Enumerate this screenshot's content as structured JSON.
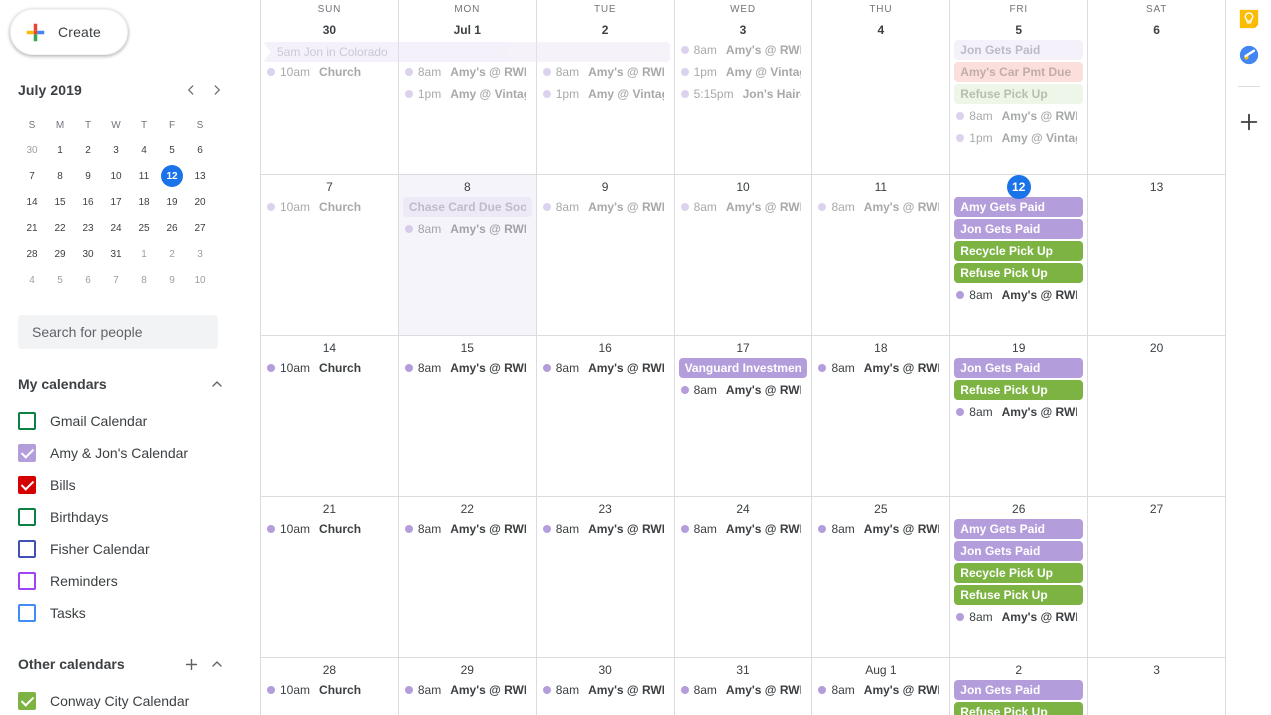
{
  "sidebar": {
    "create_button": {
      "label": "Create",
      "icon": "google-plus-icon"
    },
    "mini_calendar": {
      "title": "July 2019",
      "prev_label": "‹",
      "next_label": "›",
      "weekday_headers": [
        "S",
        "M",
        "T",
        "W",
        "T",
        "F",
        "S"
      ],
      "weeks": [
        [
          {
            "d": "30",
            "muted": true
          },
          {
            "d": "1"
          },
          {
            "d": "2"
          },
          {
            "d": "3"
          },
          {
            "d": "4"
          },
          {
            "d": "5"
          },
          {
            "d": "6"
          }
        ],
        [
          {
            "d": "7"
          },
          {
            "d": "8"
          },
          {
            "d": "9"
          },
          {
            "d": "10"
          },
          {
            "d": "11"
          },
          {
            "d": "12",
            "today": true
          },
          {
            "d": "13"
          }
        ],
        [
          {
            "d": "14"
          },
          {
            "d": "15"
          },
          {
            "d": "16"
          },
          {
            "d": "17"
          },
          {
            "d": "18"
          },
          {
            "d": "19"
          },
          {
            "d": "20"
          }
        ],
        [
          {
            "d": "21"
          },
          {
            "d": "22"
          },
          {
            "d": "23"
          },
          {
            "d": "24"
          },
          {
            "d": "25"
          },
          {
            "d": "26"
          },
          {
            "d": "27"
          }
        ],
        [
          {
            "d": "28"
          },
          {
            "d": "29"
          },
          {
            "d": "30"
          },
          {
            "d": "31"
          },
          {
            "d": "1",
            "muted": true
          },
          {
            "d": "2",
            "muted": true
          },
          {
            "d": "3",
            "muted": true
          }
        ],
        [
          {
            "d": "4",
            "muted": true
          },
          {
            "d": "5",
            "muted": true
          },
          {
            "d": "6",
            "muted": true
          },
          {
            "d": "7",
            "muted": true
          },
          {
            "d": "8",
            "muted": true
          },
          {
            "d": "9",
            "muted": true
          },
          {
            "d": "10",
            "muted": true
          }
        ]
      ]
    },
    "search_people": {
      "placeholder": "Search for people",
      "value": ""
    },
    "my_calendars": {
      "title": "My calendars",
      "collapse_icon": "chevron-up-icon",
      "items": [
        {
          "label": "Gmail Calendar",
          "color": "#0b8043",
          "checked": false
        },
        {
          "label": "Amy & Jon's Calendar",
          "color": "#b39ddb",
          "checked": true
        },
        {
          "label": "Bills",
          "color": "#d50000",
          "checked": true
        },
        {
          "label": "Birthdays",
          "color": "#0b8043",
          "checked": false
        },
        {
          "label": "Fisher Calendar",
          "color": "#3f51b5",
          "checked": false
        },
        {
          "label": "Reminders",
          "color": "#a142f4",
          "checked": false
        },
        {
          "label": "Tasks",
          "color": "#3f8df4",
          "checked": false
        }
      ]
    },
    "other_calendars": {
      "title": "Other calendars",
      "add_icon": "plus-icon",
      "collapse_icon": "chevron-up-icon",
      "items": [
        {
          "label": "Conway City Calendar",
          "color": "#7cb342",
          "checked": true
        }
      ]
    }
  },
  "rail": {
    "items": [
      {
        "name": "google-keep-icon",
        "label": "Keep"
      },
      {
        "name": "google-tasks-icon",
        "label": "Tasks"
      }
    ],
    "add_label": "+"
  },
  "colors": {
    "accent_blue": "#1a73e8",
    "purple_solid": "#b39ddb",
    "purple_pale": "#e9e2f5",
    "green_solid": "#7cb342",
    "green_pale": "#dbead0",
    "red_pale": "#f4b9b6",
    "grid_line": "#dadce0",
    "text": "#3c4043",
    "muted_text": "#70757a"
  },
  "calendar": {
    "weekday_headers": [
      "SUN",
      "MON",
      "TUE",
      "WED",
      "THU",
      "FRI",
      "SAT"
    ],
    "spanning_event": {
      "label": "5am Jon in Colorado",
      "bg": "#e9e2f5",
      "fg": "#8a8a9e",
      "start_col": 0,
      "span_cols": 3,
      "continues_from_previous": true
    },
    "weeks": [
      {
        "id": "week-jun30",
        "days": [
          {
            "num": "30",
            "shaded": false,
            "faded": true,
            "reserve_span": true,
            "events": [
              {
                "type": "timed",
                "time": "10am",
                "title": "Church",
                "dot": "#b39ddb"
              }
            ]
          },
          {
            "num": "Jul 1",
            "shaded": false,
            "faded": true,
            "reserve_span": true,
            "events": [
              {
                "type": "timed",
                "time": "8am",
                "title": "Amy's @ RWD",
                "dot": "#b39ddb"
              },
              {
                "type": "timed",
                "time": "1pm",
                "title": "Amy @ Vintage",
                "dot": "#b39ddb"
              }
            ]
          },
          {
            "num": "2",
            "shaded": false,
            "faded": true,
            "reserve_span": true,
            "events": [
              {
                "type": "timed",
                "time": "8am",
                "title": "Amy's @ RWD",
                "dot": "#b39ddb"
              },
              {
                "type": "timed",
                "time": "1pm",
                "title": "Amy @ Vintage",
                "dot": "#b39ddb"
              }
            ]
          },
          {
            "num": "3",
            "shaded": false,
            "faded": true,
            "reserve_span": false,
            "events": [
              {
                "type": "timed",
                "time": "8am",
                "title": "Amy's @ RWD",
                "dot": "#b39ddb"
              },
              {
                "type": "timed",
                "time": "1pm",
                "title": "Amy @ Vintage",
                "dot": "#b39ddb"
              },
              {
                "type": "timed",
                "time": "5:15pm",
                "title": "Jon's Haircut",
                "dot": "#b39ddb"
              }
            ]
          },
          {
            "num": "4",
            "shaded": false,
            "faded": true,
            "reserve_span": false,
            "events": []
          },
          {
            "num": "5",
            "shaded": false,
            "faded": true,
            "reserve_span": false,
            "events": [
              {
                "type": "chip",
                "title": "Jon Gets Paid",
                "bg": "#e9e2f5",
                "fg": "#6b6b80"
              },
              {
                "type": "chip",
                "title": "Amy's Car Pmt Due",
                "bg": "#f4b9b6",
                "fg": "#7a4a47"
              },
              {
                "type": "chip",
                "title": "Refuse Pick Up",
                "bg": "#dbead0",
                "fg": "#5d7350"
              },
              {
                "type": "timed",
                "time": "8am",
                "title": "Amy's @ RWD",
                "dot": "#b39ddb"
              },
              {
                "type": "timed",
                "time": "1pm",
                "title": "Amy @ Vintage",
                "dot": "#b39ddb"
              }
            ]
          },
          {
            "num": "6",
            "shaded": false,
            "faded": true,
            "reserve_span": false,
            "events": []
          }
        ]
      },
      {
        "id": "week-jul7",
        "days": [
          {
            "num": "7",
            "shaded": false,
            "faded": true,
            "events": [
              {
                "type": "timed",
                "time": "10am",
                "title": "Church",
                "dot": "#b39ddb"
              }
            ]
          },
          {
            "num": "8",
            "shaded": true,
            "faded": true,
            "events": [
              {
                "type": "chip",
                "title": "Chase Card Due Soon",
                "bg": "#e4dcf2",
                "fg": "#7d7a90"
              },
              {
                "type": "timed",
                "time": "8am",
                "title": "Amy's @ RWD",
                "dot": "#b39ddb"
              }
            ]
          },
          {
            "num": "9",
            "shaded": false,
            "faded": true,
            "events": [
              {
                "type": "timed",
                "time": "8am",
                "title": "Amy's @ RWD",
                "dot": "#b39ddb"
              }
            ]
          },
          {
            "num": "10",
            "shaded": false,
            "faded": true,
            "events": [
              {
                "type": "timed",
                "time": "8am",
                "title": "Amy's @ RWD",
                "dot": "#b39ddb"
              }
            ]
          },
          {
            "num": "11",
            "shaded": false,
            "faded": true,
            "events": [
              {
                "type": "timed",
                "time": "8am",
                "title": "Amy's @ RWD",
                "dot": "#b39ddb"
              }
            ]
          },
          {
            "num": "12",
            "today": true,
            "shaded": false,
            "faded": false,
            "events": [
              {
                "type": "chip",
                "title": "Amy Gets Paid",
                "bg": "#b39ddb",
                "fg": "#ffffff"
              },
              {
                "type": "chip",
                "title": "Jon Gets Paid",
                "bg": "#b39ddb",
                "fg": "#ffffff"
              },
              {
                "type": "chip",
                "title": "Recycle Pick Up",
                "bg": "#7cb342",
                "fg": "#ffffff"
              },
              {
                "type": "chip",
                "title": "Refuse Pick Up",
                "bg": "#7cb342",
                "fg": "#ffffff"
              },
              {
                "type": "timed",
                "time": "8am",
                "title": "Amy's @ RWD",
                "dot": "#b39ddb"
              }
            ]
          },
          {
            "num": "13",
            "shaded": false,
            "faded": false,
            "events": []
          }
        ]
      },
      {
        "id": "week-jul14",
        "days": [
          {
            "num": "14",
            "shaded": false,
            "faded": false,
            "events": [
              {
                "type": "timed",
                "time": "10am",
                "title": "Church",
                "dot": "#b39ddb"
              }
            ]
          },
          {
            "num": "15",
            "shaded": false,
            "faded": false,
            "events": [
              {
                "type": "timed",
                "time": "8am",
                "title": "Amy's @ RWD",
                "dot": "#b39ddb"
              }
            ]
          },
          {
            "num": "16",
            "shaded": false,
            "faded": false,
            "events": [
              {
                "type": "timed",
                "time": "8am",
                "title": "Amy's @ RWD",
                "dot": "#b39ddb"
              }
            ]
          },
          {
            "num": "17",
            "shaded": false,
            "faded": false,
            "events": [
              {
                "type": "chip",
                "title": "Vanguard Investment",
                "bg": "#b39ddb",
                "fg": "#ffffff"
              },
              {
                "type": "timed",
                "time": "8am",
                "title": "Amy's @ RWD",
                "dot": "#b39ddb"
              }
            ]
          },
          {
            "num": "18",
            "shaded": false,
            "faded": false,
            "events": [
              {
                "type": "timed",
                "time": "8am",
                "title": "Amy's @ RWD",
                "dot": "#b39ddb"
              }
            ]
          },
          {
            "num": "19",
            "shaded": false,
            "faded": false,
            "events": [
              {
                "type": "chip",
                "title": "Jon Gets Paid",
                "bg": "#b39ddb",
                "fg": "#ffffff"
              },
              {
                "type": "chip",
                "title": "Refuse Pick Up",
                "bg": "#7cb342",
                "fg": "#ffffff"
              },
              {
                "type": "timed",
                "time": "8am",
                "title": "Amy's @ RWD",
                "dot": "#b39ddb"
              }
            ]
          },
          {
            "num": "20",
            "shaded": false,
            "faded": false,
            "events": []
          }
        ]
      },
      {
        "id": "week-jul21",
        "days": [
          {
            "num": "21",
            "shaded": false,
            "faded": false,
            "events": [
              {
                "type": "timed",
                "time": "10am",
                "title": "Church",
                "dot": "#b39ddb"
              }
            ]
          },
          {
            "num": "22",
            "shaded": false,
            "faded": false,
            "events": [
              {
                "type": "timed",
                "time": "8am",
                "title": "Amy's @ RWD",
                "dot": "#b39ddb"
              }
            ]
          },
          {
            "num": "23",
            "shaded": false,
            "faded": false,
            "events": [
              {
                "type": "timed",
                "time": "8am",
                "title": "Amy's @ RWD",
                "dot": "#b39ddb"
              }
            ]
          },
          {
            "num": "24",
            "shaded": false,
            "faded": false,
            "events": [
              {
                "type": "timed",
                "time": "8am",
                "title": "Amy's @ RWD",
                "dot": "#b39ddb"
              }
            ]
          },
          {
            "num": "25",
            "shaded": false,
            "faded": false,
            "events": [
              {
                "type": "timed",
                "time": "8am",
                "title": "Amy's @ RWD",
                "dot": "#b39ddb"
              }
            ]
          },
          {
            "num": "26",
            "shaded": false,
            "faded": false,
            "events": [
              {
                "type": "chip",
                "title": "Amy Gets Paid",
                "bg": "#b39ddb",
                "fg": "#ffffff"
              },
              {
                "type": "chip",
                "title": "Jon Gets Paid",
                "bg": "#b39ddb",
                "fg": "#ffffff"
              },
              {
                "type": "chip",
                "title": "Recycle Pick Up",
                "bg": "#7cb342",
                "fg": "#ffffff"
              },
              {
                "type": "chip",
                "title": "Refuse Pick Up",
                "bg": "#7cb342",
                "fg": "#ffffff"
              },
              {
                "type": "timed",
                "time": "8am",
                "title": "Amy's @ RWD",
                "dot": "#b39ddb"
              }
            ]
          },
          {
            "num": "27",
            "shaded": false,
            "faded": false,
            "events": []
          }
        ]
      },
      {
        "id": "week-jul28",
        "days": [
          {
            "num": "28",
            "shaded": false,
            "faded": false,
            "events": [
              {
                "type": "timed",
                "time": "10am",
                "title": "Church",
                "dot": "#b39ddb"
              }
            ]
          },
          {
            "num": "29",
            "shaded": false,
            "faded": false,
            "events": [
              {
                "type": "timed",
                "time": "8am",
                "title": "Amy's @ RWD",
                "dot": "#b39ddb"
              }
            ]
          },
          {
            "num": "30",
            "shaded": false,
            "faded": false,
            "events": [
              {
                "type": "timed",
                "time": "8am",
                "title": "Amy's @ RWD",
                "dot": "#b39ddb"
              }
            ]
          },
          {
            "num": "31",
            "shaded": false,
            "faded": false,
            "events": [
              {
                "type": "timed",
                "time": "8am",
                "title": "Amy's @ RWD",
                "dot": "#b39ddb"
              }
            ]
          },
          {
            "num": "Aug 1",
            "shaded": false,
            "faded": false,
            "events": [
              {
                "type": "timed",
                "time": "8am",
                "title": "Amy's @ RWD",
                "dot": "#b39ddb"
              }
            ]
          },
          {
            "num": "2",
            "shaded": false,
            "faded": false,
            "events": [
              {
                "type": "chip",
                "title": "Jon Gets Paid",
                "bg": "#b39ddb",
                "fg": "#ffffff"
              },
              {
                "type": "chip",
                "title": "Refuse Pick Up",
                "bg": "#7cb342",
                "fg": "#ffffff"
              }
            ]
          },
          {
            "num": "3",
            "shaded": false,
            "faded": false,
            "events": []
          }
        ]
      }
    ]
  }
}
